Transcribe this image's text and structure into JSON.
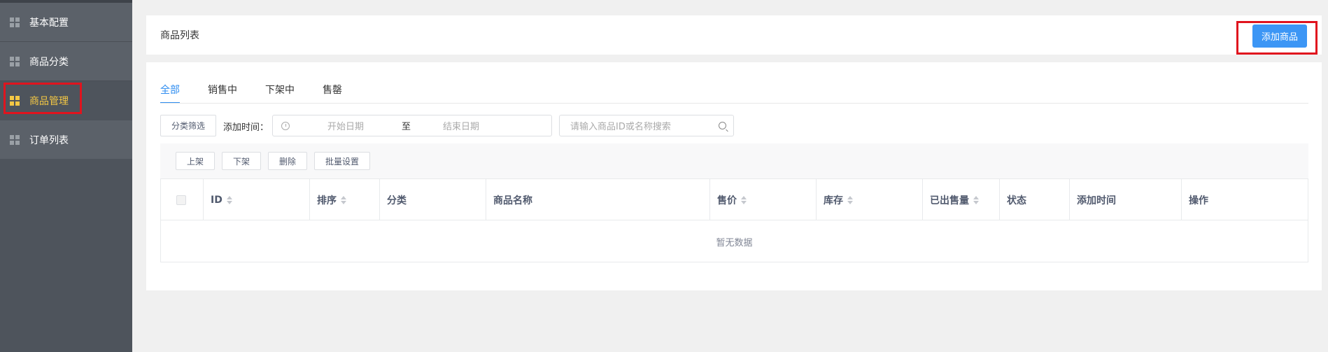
{
  "sidebar": {
    "items": [
      {
        "label": "基本配置",
        "icon": "grid-icon"
      },
      {
        "label": "商品分类",
        "icon": "grid-icon"
      },
      {
        "label": "商品管理",
        "icon": "grid-icon",
        "active": true
      },
      {
        "label": "订单列表",
        "icon": "grid-icon"
      }
    ]
  },
  "header": {
    "title": "商品列表",
    "add_button": "添加商品"
  },
  "tabs": [
    "全部",
    "销售中",
    "下架中",
    "售罄"
  ],
  "filters": {
    "category_button": "分类筛选",
    "date_label": "添加时间：",
    "date_start_placeholder": "开始日期",
    "date_separator": "至",
    "date_end_placeholder": "结束日期",
    "search_placeholder": "请输入商品ID或名称搜索"
  },
  "toolbar": {
    "shelve": "上架",
    "unshelve": "下架",
    "delete": "删除",
    "batch_settings": "批量设置"
  },
  "table": {
    "columns": [
      "ID",
      "排序",
      "分类",
      "商品名称",
      "售价",
      "库存",
      "已出售量",
      "状态",
      "添加时间",
      "操作"
    ],
    "empty_text": "暂无数据"
  },
  "colors": {
    "sidebar_bg": "#5b6169",
    "active_text": "#f4c844",
    "primary": "#3c96f5",
    "highlight_border": "#e0141e"
  }
}
